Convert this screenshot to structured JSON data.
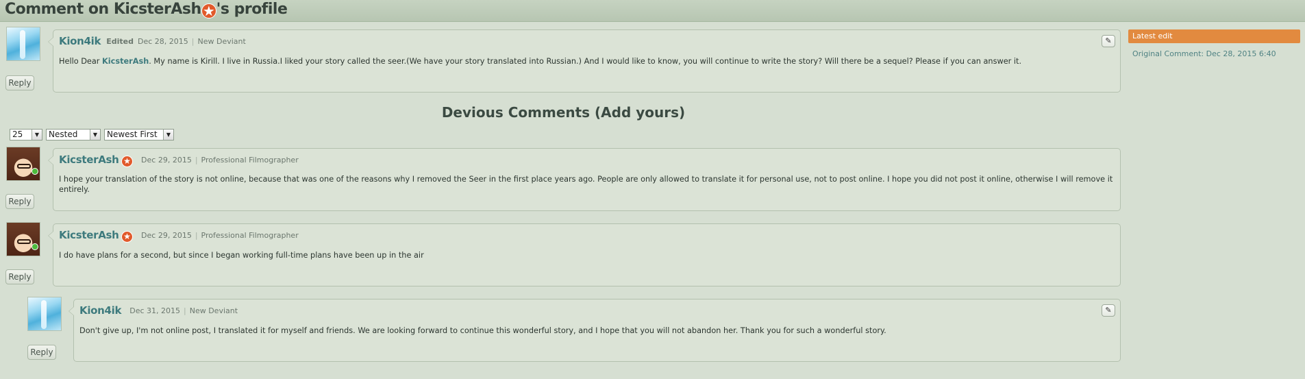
{
  "page": {
    "title_prefix": "Comment on ",
    "title_user": "KicsterAsh",
    "title_suffix": "'s profile"
  },
  "root_comment": {
    "username": "Kion4ik",
    "edited_label": "Edited",
    "date": "Dec 28, 2015",
    "role": "New Deviant",
    "text_before": "Hello Dear ",
    "mention": "KicsterAsh",
    "text_after": ". My name is Kirill. I live in Russia.I liked your story called the seer.(We have your story translated into Russian.) And I would like to know, you will continue to write the story? Will there be a sequel? Please if you can answer it.",
    "reply_label": "Reply",
    "edit_icon": "pencil-icon"
  },
  "sidebar": {
    "latest_edit_label": "Latest edit",
    "original_comment": "Original Comment: Dec 28, 2015 6:40"
  },
  "comments_section": {
    "title": "Devious Comments (Add yours)",
    "per_page": "25",
    "view_mode": "Nested",
    "sort_order": "Newest First"
  },
  "comments": [
    {
      "username": "KicsterAsh",
      "date": "Dec 29, 2015",
      "role": "Professional Filmographer",
      "text": "I hope your translation of the story is not online, because that was one of the reasons why I removed the Seer in the first place years ago. People are only allowed to translate it for personal use, not to post online. I hope you did not post it online, otherwise I will remove it entirely.",
      "reply_label": "Reply"
    },
    {
      "username": "KicsterAsh",
      "date": "Dec 29, 2015",
      "role": "Professional Filmographer",
      "text": "I do have plans for a second, but since I began working full-time plans have been up in the air",
      "reply_label": "Reply"
    },
    {
      "username": "Kion4ik",
      "date": "Dec 31, 2015",
      "role": "New Deviant",
      "text": "Don't give up, I'm not online post, I translated it for myself and friends. We are looking forward to continue this wonderful story, and I hope that you will not abandon her. Thank you for such a wonderful story.",
      "reply_label": "Reply",
      "edit_icon": "pencil-icon"
    }
  ],
  "colors": {
    "background": "#d6dfd2",
    "username": "#3d7a7d",
    "latest_edit_bg": "#e28a3f",
    "deviant_star": "#e15a2b"
  }
}
